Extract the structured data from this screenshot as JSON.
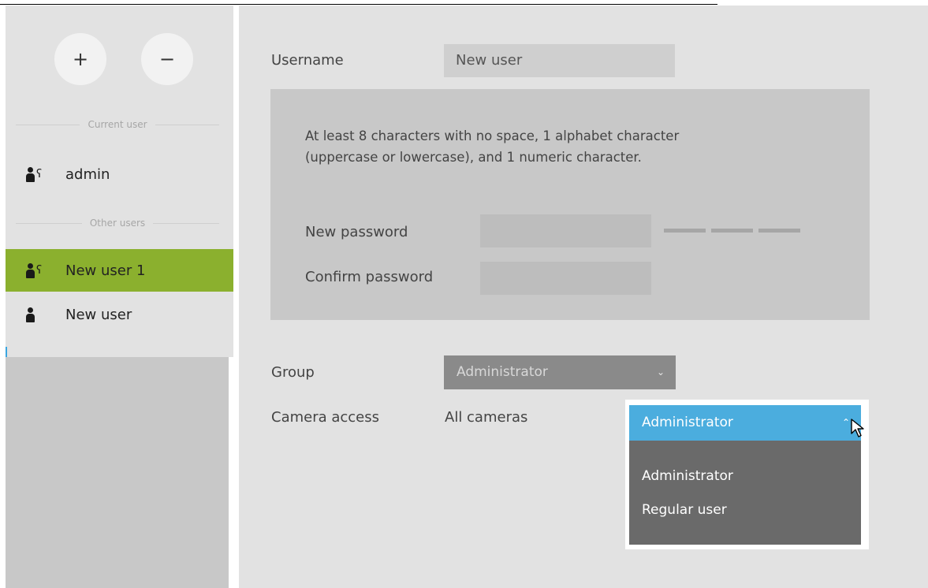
{
  "sidebar": {
    "add_button": "+",
    "remove_button": "−",
    "current_user_label": "Current user",
    "other_users_label": "Other users",
    "current_user": {
      "name": "admin",
      "icon": "admin-user-icon"
    },
    "other_users": [
      {
        "name": "New user 1",
        "icon": "admin-user-icon",
        "selected": true
      },
      {
        "name": "New user",
        "icon": "user-icon",
        "selected": false
      }
    ]
  },
  "form": {
    "username_label": "Username",
    "username_value": "New user",
    "password_hint_line1": "At least 8 characters with no space, 1 alphabet character",
    "password_hint_line2": "(uppercase or lowercase), and 1 numeric character.",
    "new_password_label": "New password",
    "confirm_password_label": "Confirm password",
    "group_label": "Group",
    "group_value": "Administrator",
    "camera_access_label": "Camera access",
    "camera_access_value": "All cameras"
  },
  "group_dropdown": {
    "selected": "Administrator",
    "options": [
      "Administrator",
      "Regular user"
    ]
  },
  "colors": {
    "selected_row": "#8bb02e",
    "dropdown_header": "#4badde",
    "dropdown_list": "#6a6a6a",
    "panel_bg": "#e2e2e2"
  }
}
